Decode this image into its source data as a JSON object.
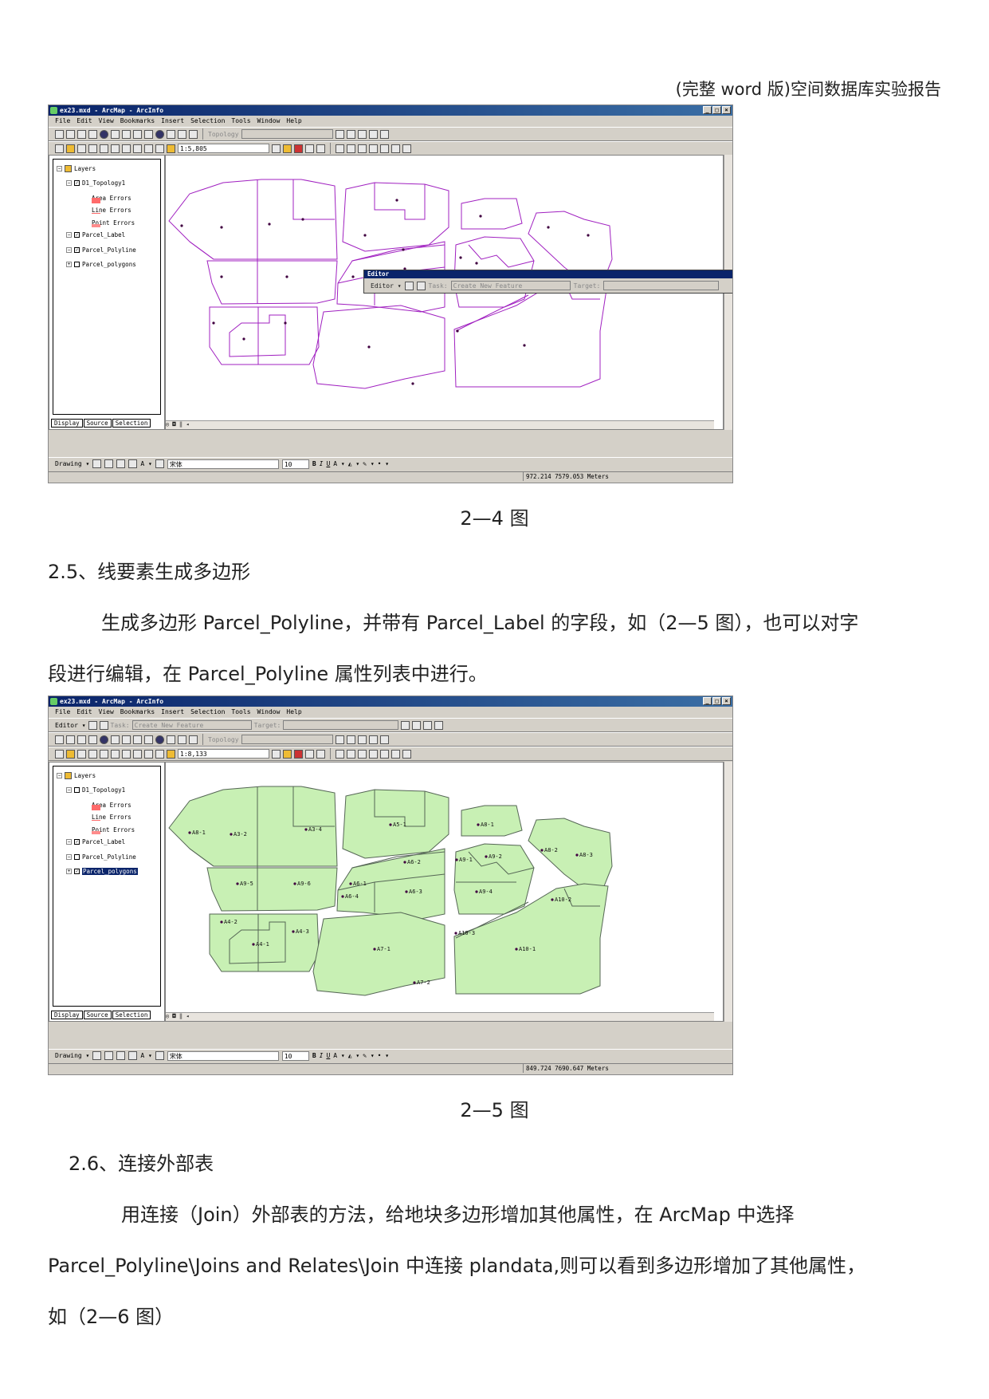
{
  "header": "(完整 word 版)空间数据库实验报告",
  "app": {
    "title": "ex23.mxd - ArcMap - ArcInfo",
    "menus": [
      "File",
      "Edit",
      "View",
      "Bookmarks",
      "Insert",
      "Selection",
      "Tools",
      "Window",
      "Help"
    ],
    "topology_label": "Topology",
    "editor_title": "Editor",
    "editor_label": "Editor ▾",
    "task_label": "Task:",
    "task_value": "Create New Feature",
    "target_label": "Target:",
    "drawing_label": "Drawing ▾",
    "font_name": "宋体",
    "font_size": "10",
    "layers_label": "Layers",
    "tabs": [
      "Display",
      "Source",
      "Selection"
    ],
    "layers": [
      {
        "name": "D1_Topology1"
      },
      {
        "name": "Area Errors"
      },
      {
        "name": "Line Errors"
      },
      {
        "name": "Point Errors"
      },
      {
        "name": "Parcel_Label"
      },
      {
        "name": "Parcel_Polyline"
      },
      {
        "name": "Parcel_polygons"
      }
    ]
  },
  "shot1": {
    "scale": "1:5,805",
    "coords": "972.214  7579.053 Meters"
  },
  "shot2": {
    "scale": "1:8,133",
    "coords": "849.724  7690.647 Meters",
    "labels": [
      "A8-1",
      "A3-2",
      "A3-4",
      "A5-1",
      "A8-1",
      "A9-5",
      "A9-6",
      "A6-2",
      "A6-1",
      "A6-3",
      "A6-4",
      "A8-2",
      "A8-3",
      "A9-1",
      "A9-2",
      "A9-4",
      "A10-2",
      "A4-2",
      "A4-3",
      "A4-1",
      "A7-1",
      "A7-2",
      "A10-3",
      "A10-1"
    ]
  },
  "captions": {
    "fig4": "2—4 图",
    "fig5": "2—5 图"
  },
  "text": {
    "s25": "2.5、线要素生成多边形",
    "p25a": "生成多边形 Parcel_Polyline，并带有 Parcel_Label 的字段，如（2—5 图），也可以对字",
    "p25b": "段进行编辑，在 Parcel_Polyline 属性列表中进行。",
    "s26": "2.6、连接外部表",
    "p26a": "用连接（Join）外部表的方法，给地块多边形增加其他属性，在 ArcMap 中选择",
    "p26b": "Parcel_Polyline\\Joins and Relates\\Join 中连接 plandata,则可以看到多边形增加了其他属性，",
    "p26c": "如（2—6 图）"
  },
  "colors": {
    "outline": "#a020c0",
    "fill": "#c8f0b4",
    "fill_stroke": "#556655",
    "titlebar": "#0a246a"
  }
}
